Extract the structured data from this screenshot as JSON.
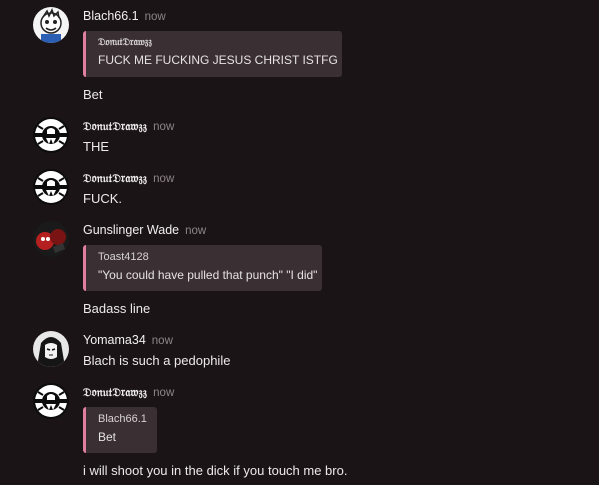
{
  "messages": [
    {
      "author": "Blach66.1",
      "time": "now",
      "quote": {
        "author": "𝔇𝔬𝔫𝔲𝔱𝔇𝔯𝔞𝔴𝔷𝔷",
        "text": "FUCK ME FUCKING JESUS CHRIST ISTFG"
      },
      "text": "Bet"
    },
    {
      "author": "𝔇𝔬𝔫𝔲𝔱𝔇𝔯𝔞𝔴𝔷𝔷",
      "time": "now",
      "text": "THE"
    },
    {
      "author": "𝔇𝔬𝔫𝔲𝔱𝔇𝔯𝔞𝔴𝔷𝔷",
      "time": "now",
      "text": "FUCK."
    },
    {
      "author": "Gunslinger Wade",
      "time": "now",
      "quote": {
        "author": "Toast4128",
        "text": "\"You could have pulled that punch\" \"I did\""
      },
      "text": "Badass line"
    },
    {
      "author": "Yomama34",
      "time": "now",
      "text": "Blach is such a pedophile"
    },
    {
      "author": "𝔇𝔬𝔫𝔲𝔱𝔇𝔯𝔞𝔴𝔷𝔷",
      "time": "now",
      "quote": {
        "author": "Blach66.1",
        "text": "Bet"
      },
      "text": "i will shoot you in the dick if you touch me bro."
    }
  ],
  "colors": {
    "background": "#1b1417",
    "quote_bar": "#e07fa0",
    "quote_bg": "#3a3033",
    "timestamp": "#8d8588"
  },
  "icons": {
    "avatar_blach": "cartoon-face-avatar",
    "avatar_donut": "skull-logo-avatar",
    "avatar_gunslinger": "red-character-avatar",
    "avatar_yomama": "anime-character-avatar"
  }
}
